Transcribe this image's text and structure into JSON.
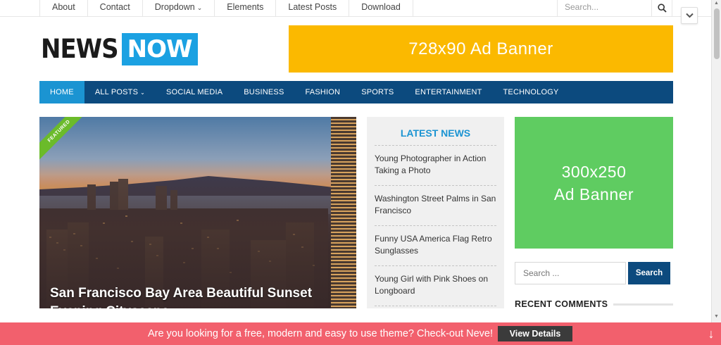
{
  "topnav": {
    "items": [
      {
        "label": "About"
      },
      {
        "label": "Contact"
      },
      {
        "label": "Dropdown"
      },
      {
        "label": "Elements"
      },
      {
        "label": "Latest Posts"
      },
      {
        "label": "Download"
      }
    ],
    "search_placeholder": "Search...",
    "search_icon": "search-icon"
  },
  "logo": {
    "part1": "NEWS",
    "part2": "NOW"
  },
  "ad_top": {
    "label": "728x90 Ad Banner",
    "color": "#fbb900"
  },
  "mainnav": {
    "items": [
      {
        "label": "HOME"
      },
      {
        "label": "ALL POSTS"
      },
      {
        "label": "SOCIAL MEDIA"
      },
      {
        "label": "BUSINESS"
      },
      {
        "label": "FASHION"
      },
      {
        "label": "SPORTS"
      },
      {
        "label": "ENTERTAINMENT"
      },
      {
        "label": "TECHNOLOGY"
      }
    ],
    "active": "HOME",
    "bg_color": "#0c4a7e",
    "active_color": "#1b94d2"
  },
  "featured": {
    "badge": "FEATURED",
    "title": "San Francisco Bay Area Beautiful Sunset Evening Cityscape"
  },
  "latest_news": {
    "title": "LATEST NEWS",
    "items": [
      {
        "title": "Young Photographer in Action Taking a Photo"
      },
      {
        "title": "Washington Street Palms in San Francisco"
      },
      {
        "title": "Funny USA America Flag Retro Sunglasses"
      },
      {
        "title": "Young Girl with Pink Shoes on Longboard"
      }
    ]
  },
  "ad_side": {
    "line1": "300x250",
    "line2": "Ad Banner",
    "color": "#5fcc61"
  },
  "sidebar_search": {
    "placeholder": "Search ...",
    "button": "Search"
  },
  "recent_comments": {
    "title": "RECENT COMMENTS"
  },
  "bottom_bar": {
    "message": "Are you looking for a free, modern and easy to use theme? Check-out Neve!",
    "button": "View Details",
    "color": "#f2606d"
  }
}
